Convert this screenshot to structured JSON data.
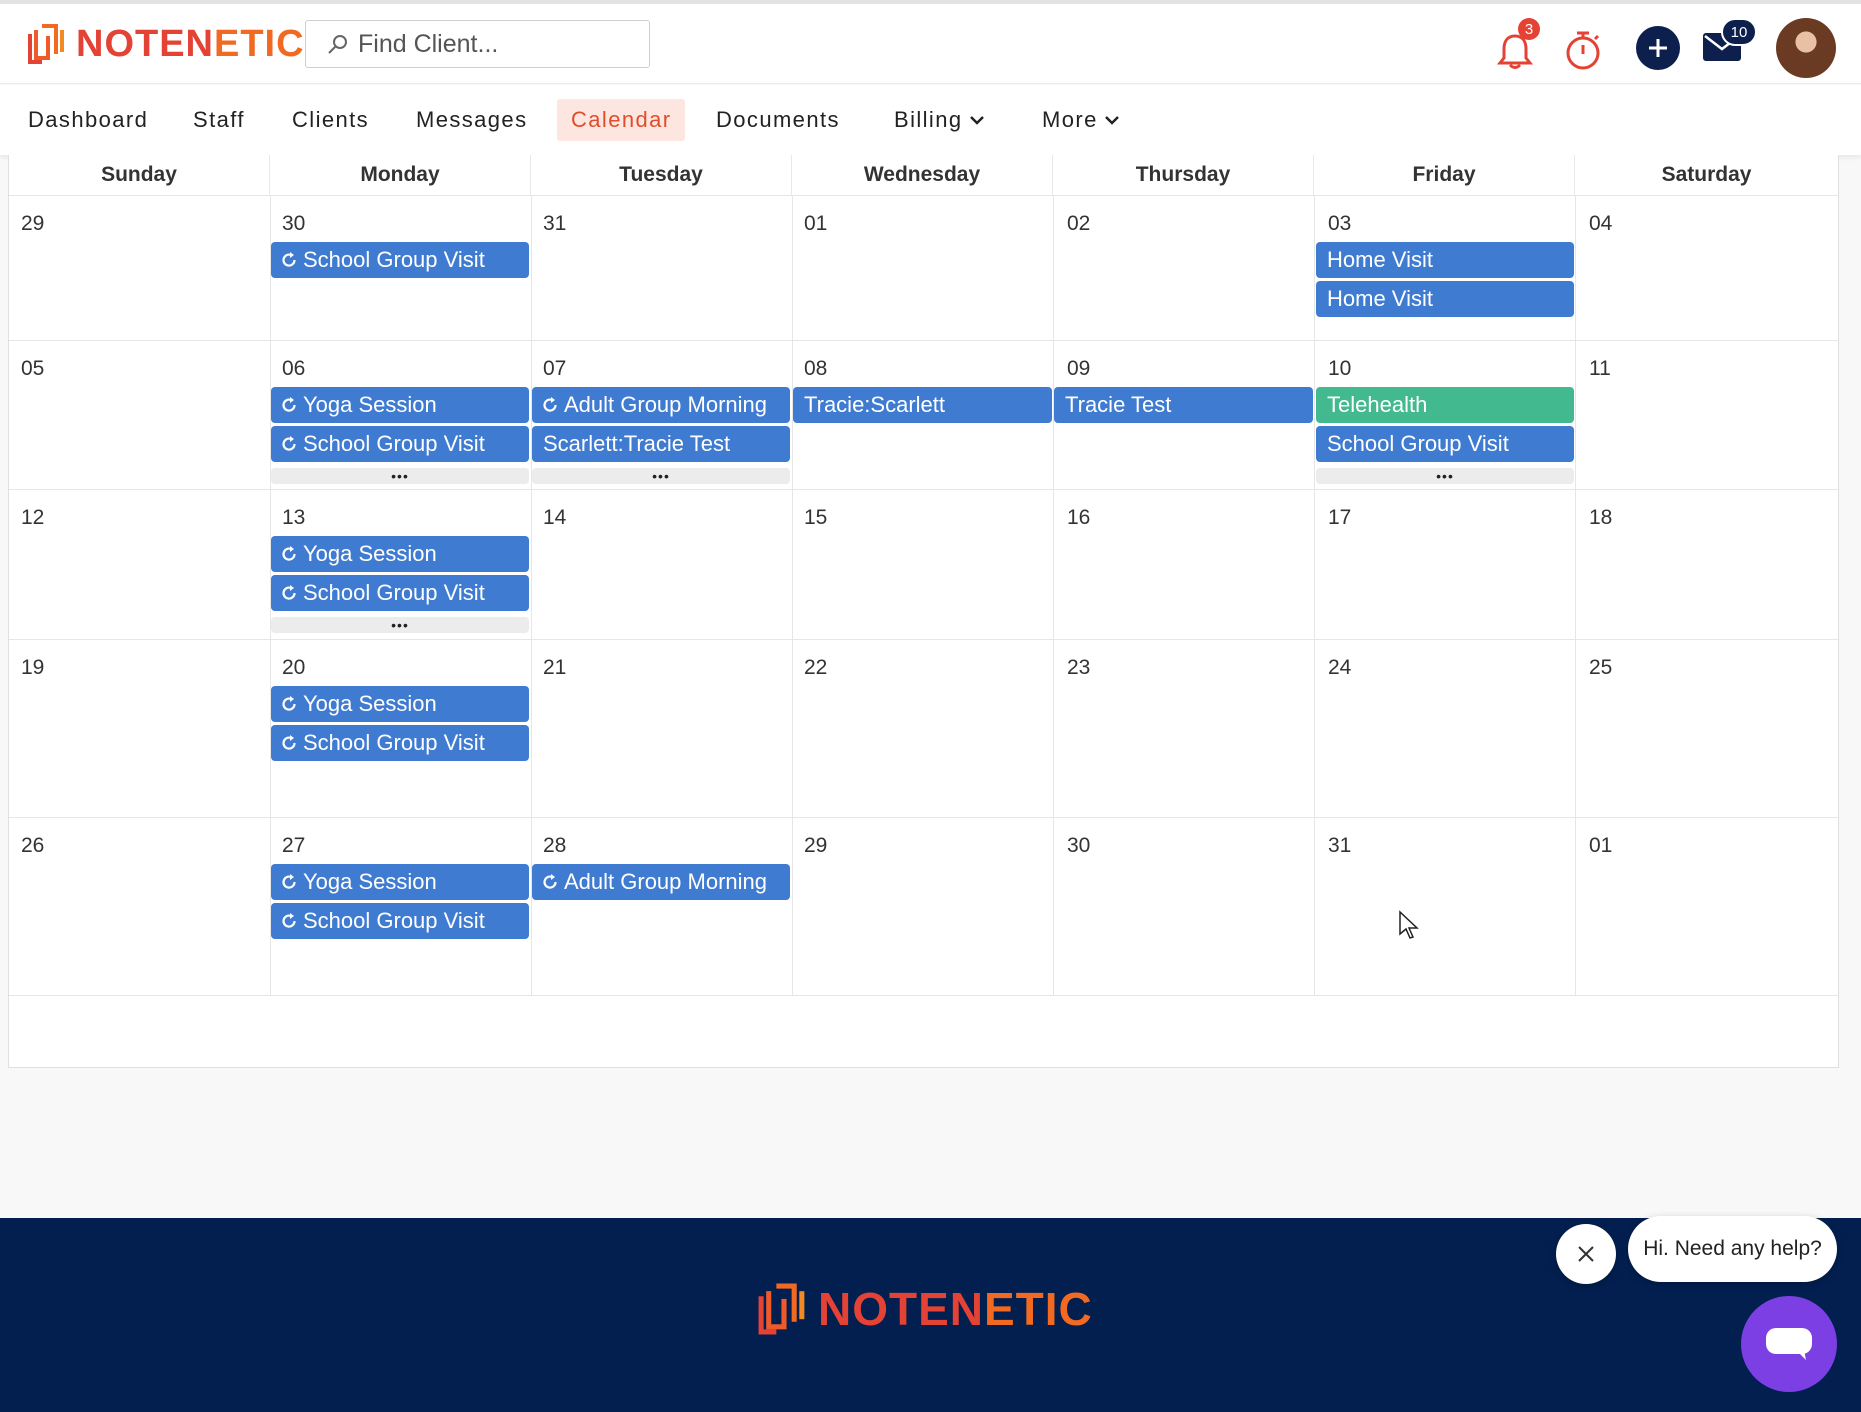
{
  "brand": {
    "name_part1": "NOTEN",
    "name_part2": "ETIC",
    "accent": "#f26a21",
    "red": "#e34234",
    "navy": "#021f4f"
  },
  "search": {
    "placeholder": "Find Client..."
  },
  "header": {
    "notifications_count": "3",
    "messages_count": "10",
    "icons": [
      "bell-icon",
      "timer-icon",
      "add-icon",
      "mail-icon",
      "avatar"
    ]
  },
  "nav": {
    "items": [
      {
        "label": "Dashboard"
      },
      {
        "label": "Staff"
      },
      {
        "label": "Clients"
      },
      {
        "label": "Messages"
      },
      {
        "label": "Calendar",
        "active": true
      },
      {
        "label": "Documents"
      },
      {
        "label": "Billing",
        "dropdown": true
      },
      {
        "label": "More",
        "dropdown": true
      }
    ]
  },
  "calendar": {
    "days_of_week": [
      "Sunday",
      "Monday",
      "Tuesday",
      "Wednesday",
      "Thursday",
      "Friday",
      "Saturday"
    ],
    "weeks": [
      [
        "29",
        "30",
        "31",
        "01",
        "02",
        "03",
        "04"
      ],
      [
        "05",
        "06",
        "07",
        "08",
        "09",
        "10",
        "11"
      ],
      [
        "12",
        "13",
        "14",
        "15",
        "16",
        "17",
        "18"
      ],
      [
        "19",
        "20",
        "21",
        "22",
        "23",
        "24",
        "25"
      ],
      [
        "26",
        "27",
        "28",
        "29",
        "30",
        "31",
        "01"
      ]
    ],
    "events": {
      "w0_mon_1": "School Group Visit",
      "w0_fri_1": "Home Visit",
      "w0_fri_2": "Home Visit",
      "w1_mon_1": "Yoga Session",
      "w1_mon_2": "School Group Visit",
      "w1_tue_1": "Adult Group Morning",
      "w1_tue_2": "Scarlett:Tracie Test",
      "w1_wed_1": "Tracie:Scarlett",
      "w1_thu_1": "Tracie Test",
      "w1_fri_1": "Telehealth",
      "w1_fri_2": "School Group Visit",
      "w2_mon_1": "Yoga Session",
      "w2_mon_2": "School Group Visit",
      "w3_mon_1": "Yoga Session",
      "w3_mon_2": "School Group Visit",
      "w4_mon_1": "Yoga Session",
      "w4_mon_2": "School Group Visit",
      "w4_tue_1": "Adult Group Morning"
    },
    "more_label": "•••",
    "event_colors": {
      "default": "#3f7bd0",
      "telehealth": "#42b98e"
    }
  },
  "chat": {
    "greeting": "Hi. Need any help?"
  }
}
